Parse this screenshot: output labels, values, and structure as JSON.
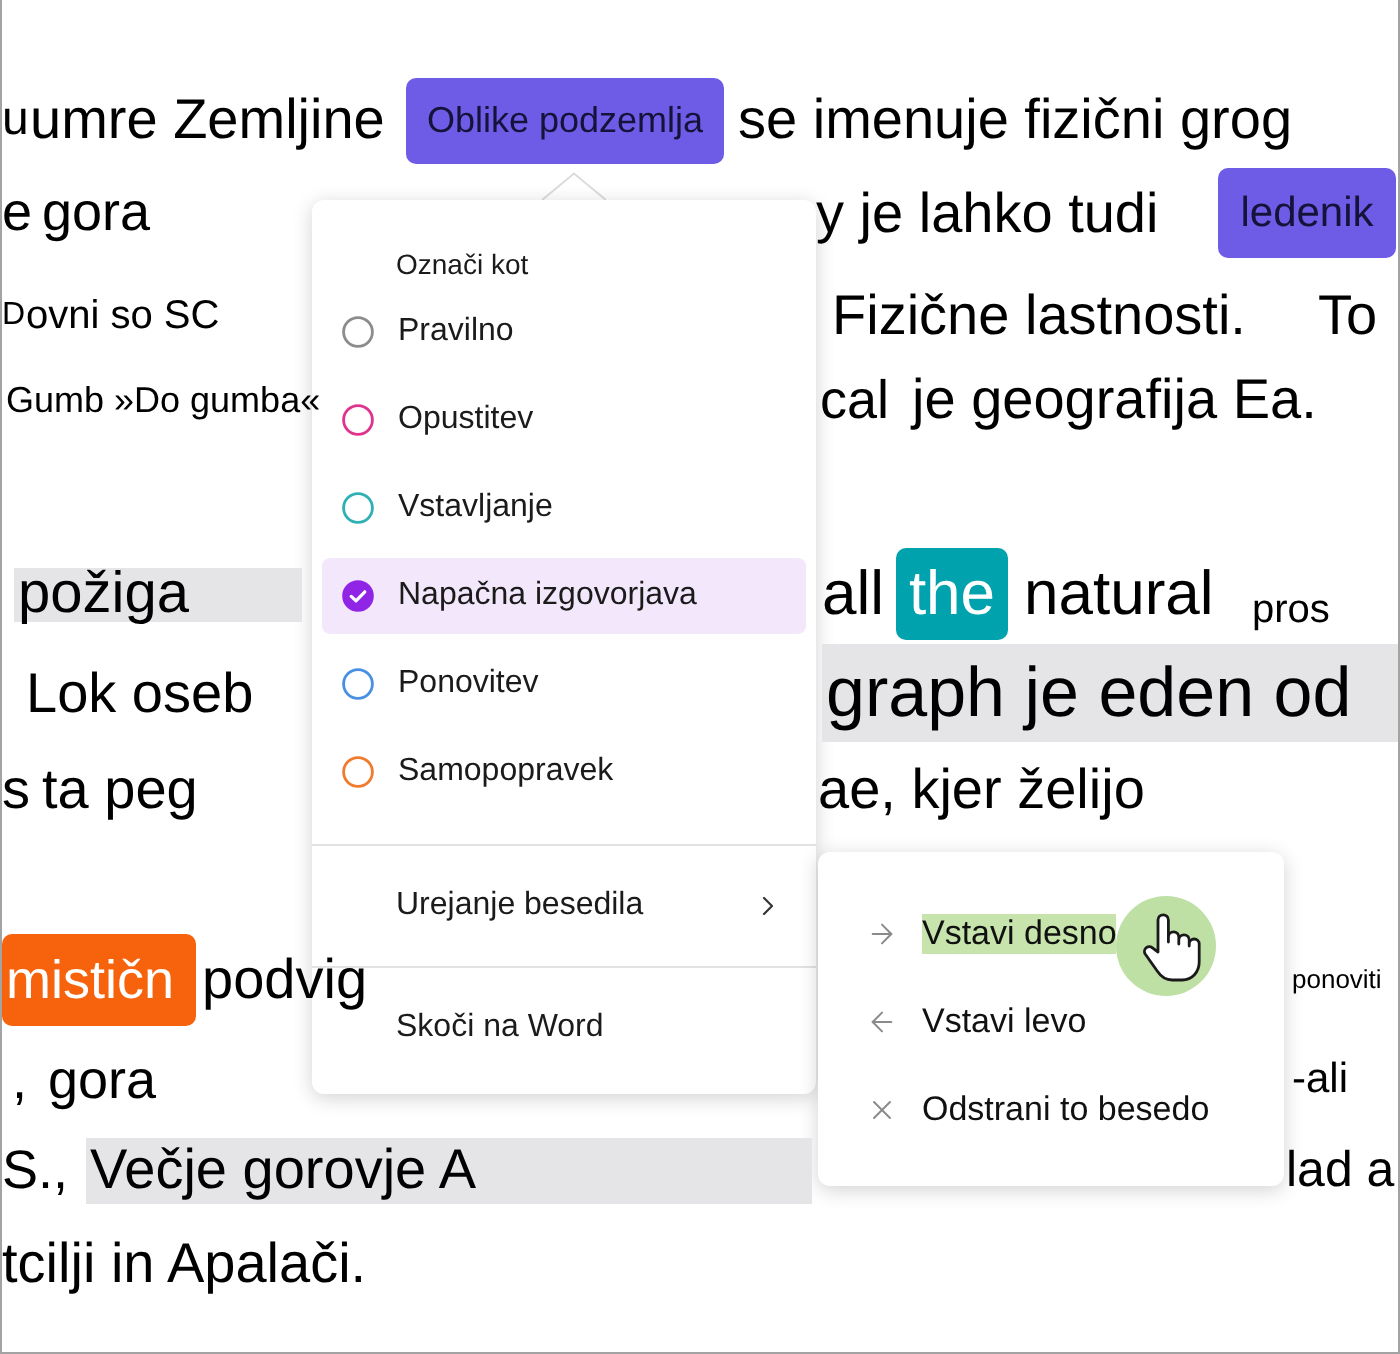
{
  "document": {
    "lines": [
      {
        "fragments": [
          {
            "kind": "plain",
            "text": "u"
          },
          {
            "kind": "plain",
            "text": "umre Zemljine"
          },
          {
            "kind": "tag",
            "text": "Oblike podzemlja",
            "color": "#6e5ce6"
          },
          {
            "kind": "plain",
            "text": "se imenuje fizični grog"
          }
        ]
      },
      {
        "fragments": [
          {
            "kind": "plain",
            "text": "e"
          },
          {
            "kind": "plain",
            "text": "gora"
          },
          {
            "kind": "plain",
            "text": "y je lahko tudi"
          },
          {
            "kind": "tag",
            "text": "ledenik",
            "color": "#6e5ce6"
          }
        ]
      },
      {
        "fragments": [
          {
            "kind": "plain",
            "text": "D"
          },
          {
            "kind": "plain",
            "text": "ovni so SC"
          },
          {
            "kind": "plain",
            "text": "Fizične lastnosti."
          },
          {
            "kind": "plain",
            "text": "To"
          }
        ]
      },
      {
        "fragments": [
          {
            "kind": "plain",
            "text": "Gumb »Do gumba«"
          },
          {
            "kind": "plain",
            "text": "cal"
          },
          {
            "kind": "plain",
            "text": "je geografija Ea."
          }
        ]
      },
      {
        "fragments": [
          {
            "kind": "shaded",
            "text": "požiga"
          },
          {
            "kind": "plain",
            "text": "all"
          },
          {
            "kind": "marker",
            "text": "the",
            "color": "#00a3ad"
          },
          {
            "kind": "plain",
            "text": "natural"
          },
          {
            "kind": "plain",
            "text": "pros"
          }
        ]
      },
      {
        "fragments": [
          {
            "kind": "plain",
            "text": "Lok oseb"
          },
          {
            "kind": "shaded",
            "text": "graph je eden od"
          }
        ]
      },
      {
        "fragments": [
          {
            "kind": "plain",
            "text": "s"
          },
          {
            "kind": "plain",
            "text": "ta peg"
          },
          {
            "kind": "plain",
            "text": "ae, kjer želijo"
          }
        ]
      },
      {
        "fragments": [
          {
            "kind": "marker",
            "text": "mističn",
            "color": "#f7630c"
          },
          {
            "kind": "plain",
            "text": "podvig"
          },
          {
            "kind": "plain",
            "text": "ponoviti"
          }
        ]
      },
      {
        "fragments": [
          {
            "kind": "plain",
            "text": ","
          },
          {
            "kind": "plain",
            "text": "gora"
          },
          {
            "kind": "plain",
            "text": "-ali"
          }
        ]
      },
      {
        "fragments": [
          {
            "kind": "plain",
            "text": "S.,"
          },
          {
            "kind": "shaded",
            "text": "Večje gorovje A"
          },
          {
            "kind": "plain",
            "text": "lad a"
          }
        ]
      },
      {
        "fragments": [
          {
            "kind": "plain",
            "text": "tcilji in Apalači."
          }
        ]
      }
    ]
  },
  "popup_menu": {
    "heading": "Označi kot",
    "options": [
      {
        "label": "Pravilno",
        "color": "#8c8c8c",
        "selected": false
      },
      {
        "label": "Opustitev",
        "color": "#e0338f",
        "selected": false
      },
      {
        "label": "Vstavljanje",
        "color": "#2fb0b5",
        "selected": false
      },
      {
        "label": "Napačna izgovorjava",
        "color": "#9025e6",
        "selected": true
      },
      {
        "label": "Ponovitev",
        "color": "#4a90e2",
        "selected": false
      },
      {
        "label": "Samopopravek",
        "color": "#f07b2d",
        "selected": false
      }
    ],
    "actions": [
      {
        "kind": "submenu",
        "label": "Urejanje besedila",
        "expanded": true,
        "submenu": [
          {
            "kind": "insert_right",
            "label": "Vstavi desno",
            "hovered": true
          },
          {
            "kind": "insert_left",
            "label": "Vstavi levo",
            "hovered": false
          },
          {
            "kind": "remove",
            "label": "Odstrani to besedo",
            "hovered": false
          }
        ]
      },
      {
        "kind": "command",
        "label": "Skoči na Word"
      }
    ]
  }
}
